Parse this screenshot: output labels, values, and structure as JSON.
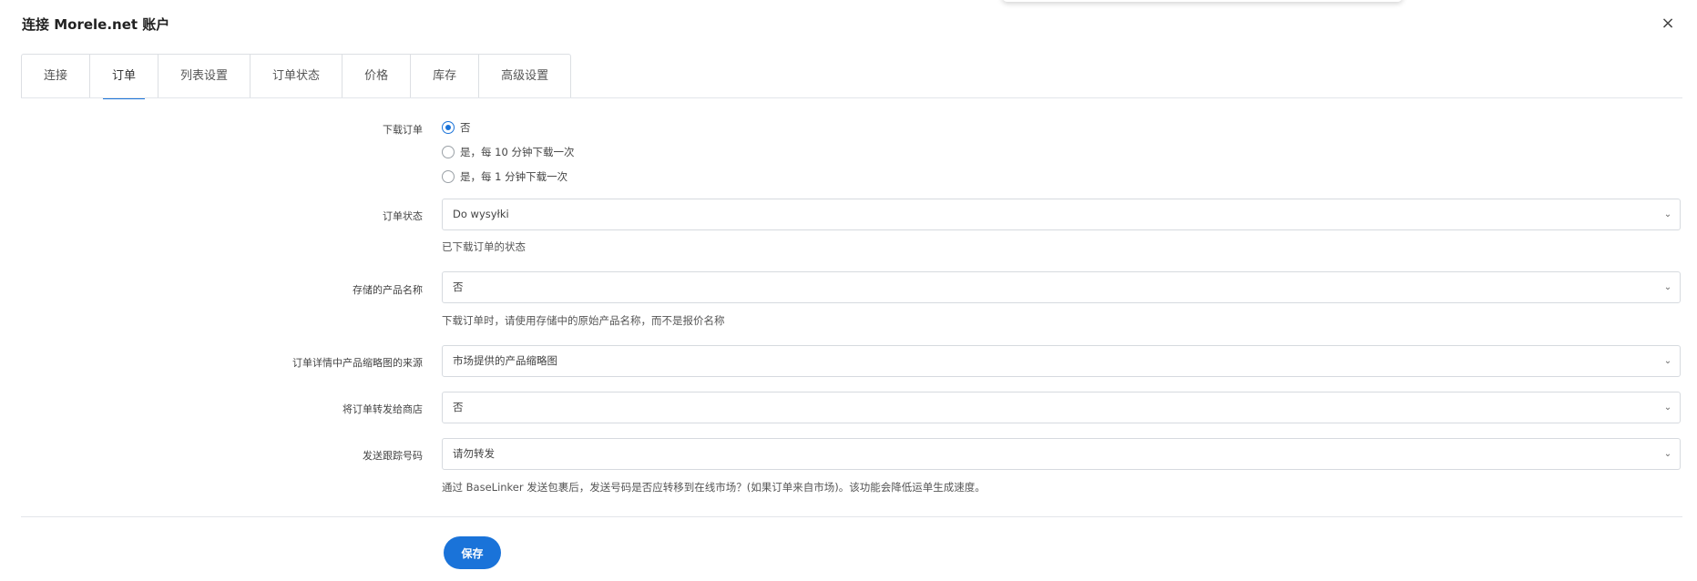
{
  "modal": {
    "title": "连接 Morele.net 账户",
    "close_icon": "×"
  },
  "tabs": [
    {
      "label": "连接"
    },
    {
      "label": "订单",
      "active": true
    },
    {
      "label": "列表设置"
    },
    {
      "label": "订单状态"
    },
    {
      "label": "价格"
    },
    {
      "label": "库存"
    },
    {
      "label": "高级设置"
    }
  ],
  "form": {
    "download_orders": {
      "label": "下载订单",
      "options": [
        {
          "label": "否",
          "checked": true
        },
        {
          "label": "是，每 10 分钟下载一次",
          "checked": false
        },
        {
          "label": "是，每 1 分钟下载一次",
          "checked": false
        }
      ]
    },
    "order_status": {
      "label": "订单状态",
      "value": "Do wysyłki",
      "hint": "已下载订单的状态"
    },
    "stored_product_name": {
      "label": "存储的产品名称",
      "value": "否",
      "hint": "下载订单时，请使用存储中的原始产品名称，而不是报价名称"
    },
    "thumbnail_source": {
      "label": "订单详情中产品缩略图的来源",
      "value": "市场提供的产品缩略图"
    },
    "forward_to_shop": {
      "label": "将订单转发给商店",
      "value": "否"
    },
    "send_tracking": {
      "label": "发送跟踪号码",
      "value": "请勿转发",
      "hint": "通过 BaseLinker 发送包裹后，发送号码是否应转移到在线市场？(如果订单来自市场)。该功能会降低运单生成速度。"
    }
  },
  "save_label": "保存",
  "colors": {
    "accent": "#1a73d9"
  }
}
